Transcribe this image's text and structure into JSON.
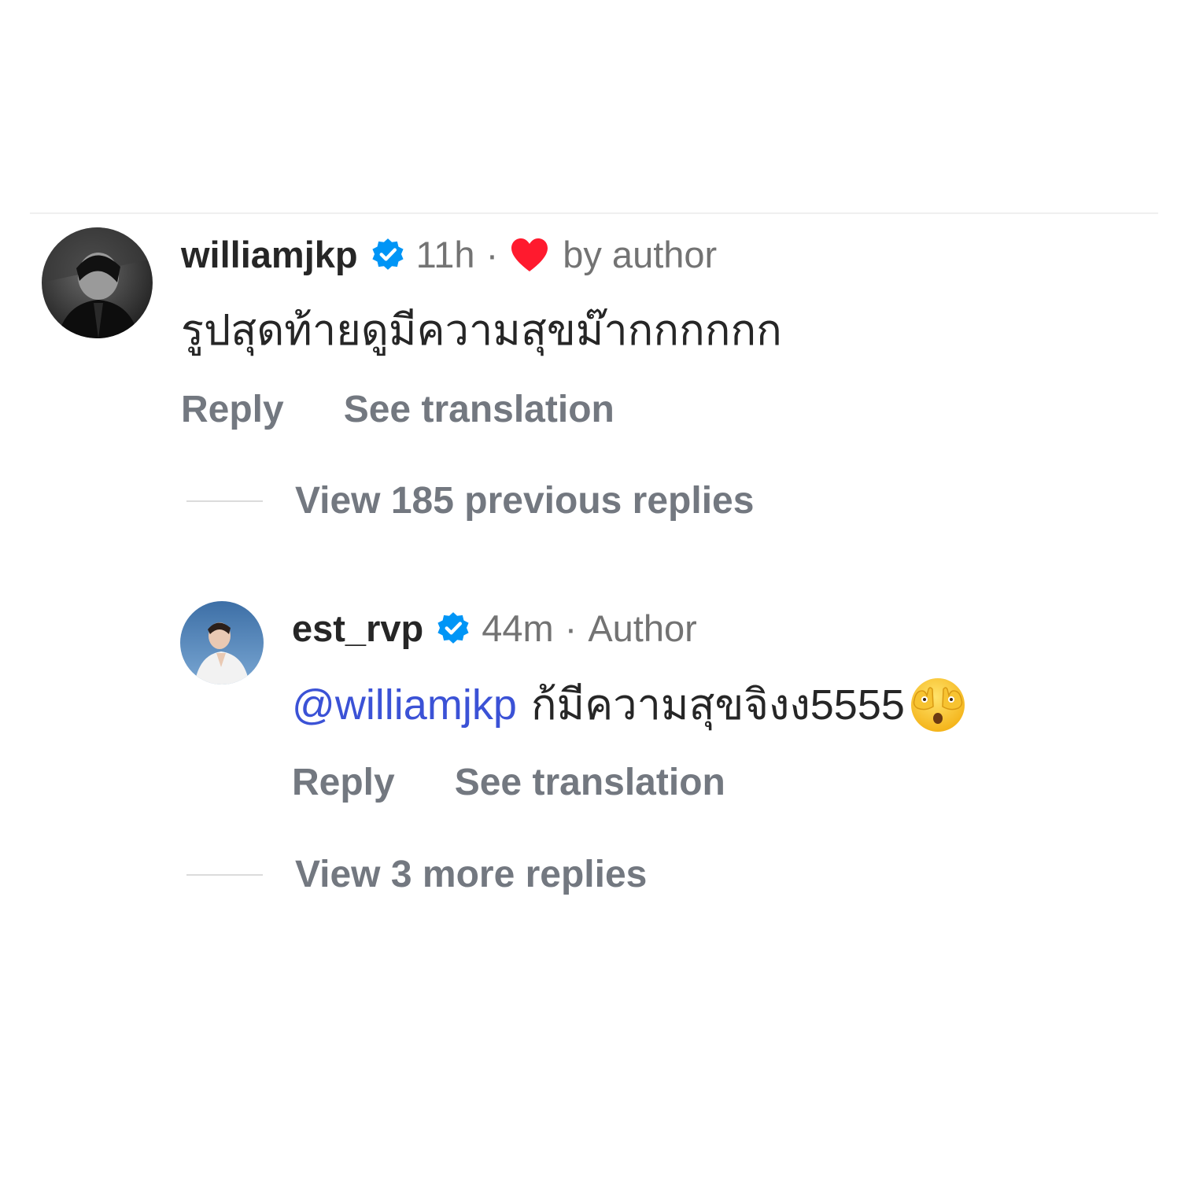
{
  "comment": {
    "username": "williamjkp",
    "time": "11h",
    "separator": "·",
    "liked_label": "by author",
    "text": "รูปสุดท้ายดูมีความสุขม๊ากกกกกก",
    "reply_label": "Reply",
    "translate_label": "See translation",
    "view_replies_label": "View 185 previous replies"
  },
  "reply": {
    "username": "est_rvp",
    "time": "44m",
    "separator": "·",
    "role_label": "Author",
    "mention": "@williamjkp",
    "text": "ก้มีความสุขจิงง5555",
    "reply_label": "Reply",
    "translate_label": "See translation",
    "view_more_label": "View 3 more replies"
  },
  "colors": {
    "verified": "#0095f6",
    "heart": "#ff3040",
    "mention": "#3b52d6",
    "muted": "#737880"
  },
  "icons": {
    "verified": "verified-badge-icon",
    "heart": "heart-icon",
    "emoji": "face-with-hands-covering-eyes-emoji"
  }
}
